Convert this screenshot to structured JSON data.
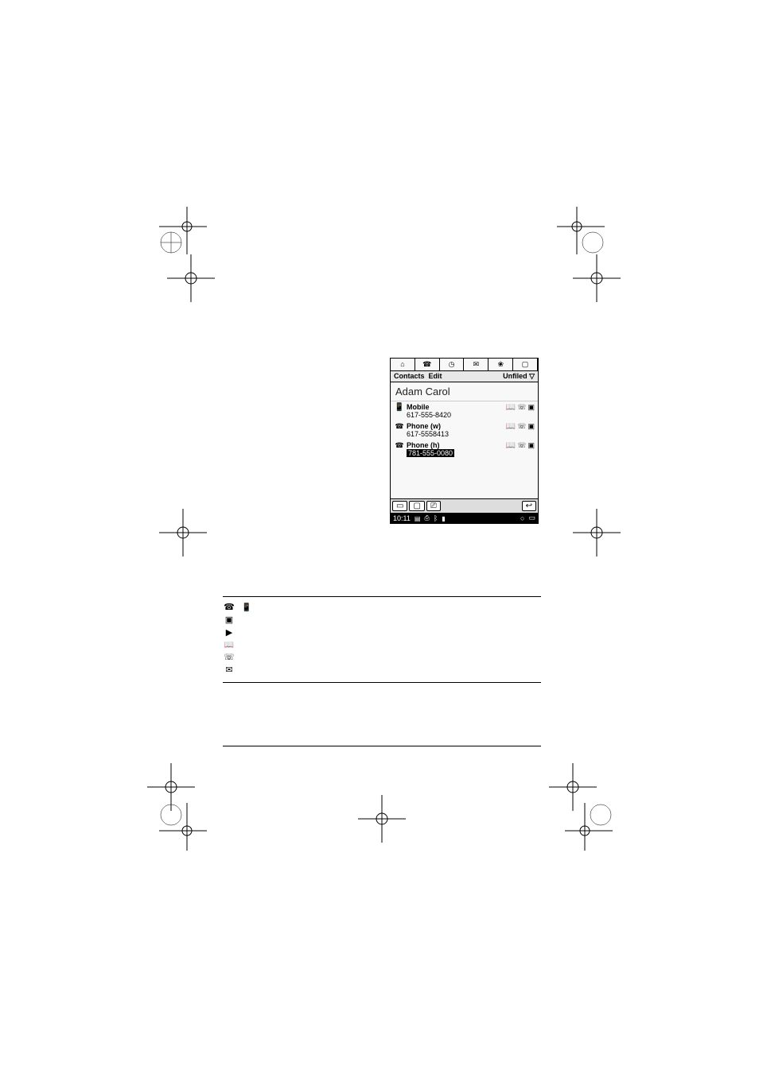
{
  "page_number": "",
  "intro_text_1": "",
  "intro_text_2": "",
  "screenshot": {
    "menu_contacts": "Contacts",
    "menu_edit": "Edit",
    "menu_category": "Unfiled ▽",
    "title": "Adam Carol",
    "entries": [
      {
        "icon": "g-mobile",
        "label": "Mobile",
        "number": "617-555-8420",
        "hilite": false
      },
      {
        "icon": "g-phone",
        "label": "Phone (w)",
        "number": "617-5558413",
        "hilite": false
      },
      {
        "icon": "g-phone",
        "label": "Phone (h)",
        "number": "781-555-0080",
        "hilite": true
      }
    ],
    "status_time": "10:11"
  },
  "bullets": [
    {
      "icons": [
        "g-phone",
        "g-mobile"
      ],
      "text": ""
    },
    {
      "icons": [
        "g-vcall"
      ],
      "text": ""
    },
    {
      "icons": [
        "g-vcall2"
      ],
      "text": ""
    },
    {
      "icons": [
        "g-phonebook"
      ],
      "text": ""
    },
    {
      "icons": [
        "g-atphone"
      ],
      "text": ""
    },
    {
      "icons": [
        "g-mms"
      ],
      "text": ""
    }
  ]
}
